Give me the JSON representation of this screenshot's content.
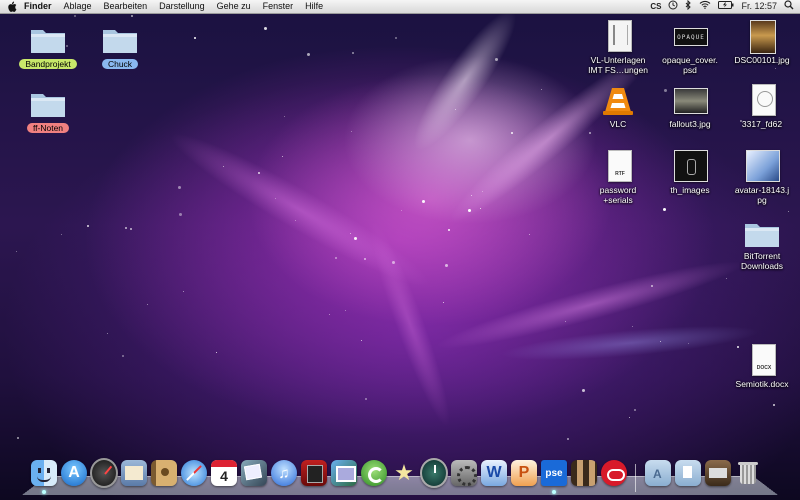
{
  "menubar": {
    "apple_icon": "apple-icon",
    "items": [
      "Finder",
      "Ablage",
      "Bearbeiten",
      "Darstellung",
      "Gehe zu",
      "Fenster",
      "Hilfe"
    ],
    "status": {
      "clock": "Fr. 12:57",
      "icons": [
        "cs-icon",
        "time-machine-icon",
        "bluetooth-icon",
        "wifi-icon",
        "battery-icon",
        "spotlight-icon"
      ]
    }
  },
  "desktop_left": [
    {
      "label": "Bandprojekt",
      "tag": "#c8e86a",
      "kind": "folder"
    },
    {
      "label": "Chuck",
      "tag": "#8ab8f0",
      "kind": "folder"
    },
    {
      "label": "ff-Noten",
      "tag": "#f08080",
      "kind": "folder"
    }
  ],
  "desktop_right": [
    {
      "label": "VL-Unterlagen\nIMT FS…ungen",
      "kind": "document"
    },
    {
      "label": "opaque_cover.\npsd",
      "kind": "image"
    },
    {
      "label": "DSC00101.jpg",
      "kind": "image"
    },
    {
      "label": "VLC",
      "kind": "app"
    },
    {
      "label": "fallout3.jpg",
      "kind": "image"
    },
    {
      "label": "3317_fd62",
      "kind": "document"
    },
    {
      "label": "password\n+serials",
      "kind": "document",
      "ext": "RTF"
    },
    {
      "label": "th_images",
      "kind": "image"
    },
    {
      "label": "avatar-18143.j\npg",
      "kind": "image"
    },
    {
      "label": "BitTorrent\nDownloads",
      "kind": "folder"
    },
    {
      "label": "Semiotik.docx",
      "kind": "document",
      "ext": "DOCX"
    }
  ],
  "image_text": {
    "opaque_logo": "OPAQUE",
    "cal_day": "4",
    "pse_label": "pse"
  },
  "dock": {
    "apps": [
      "finder-icon",
      "app-store-icon",
      "dashboard-icon",
      "mail-icon",
      "address-book-icon",
      "safari-icon",
      "ical-icon",
      "preview-icon",
      "itunes-icon",
      "photo-booth-icon",
      "iphoto-icon",
      "bittorrent-icon",
      "imovie-icon",
      "time-machine-icon",
      "system-preferences-icon",
      "word-icon",
      "powerpoint-icon",
      "photoshop-elements-icon",
      "chess-icon",
      "lastfm-icon"
    ],
    "stacks": [
      "applications-folder-icon",
      "documents-folder-icon",
      "downloads-stack-icon",
      "trash-icon"
    ]
  }
}
